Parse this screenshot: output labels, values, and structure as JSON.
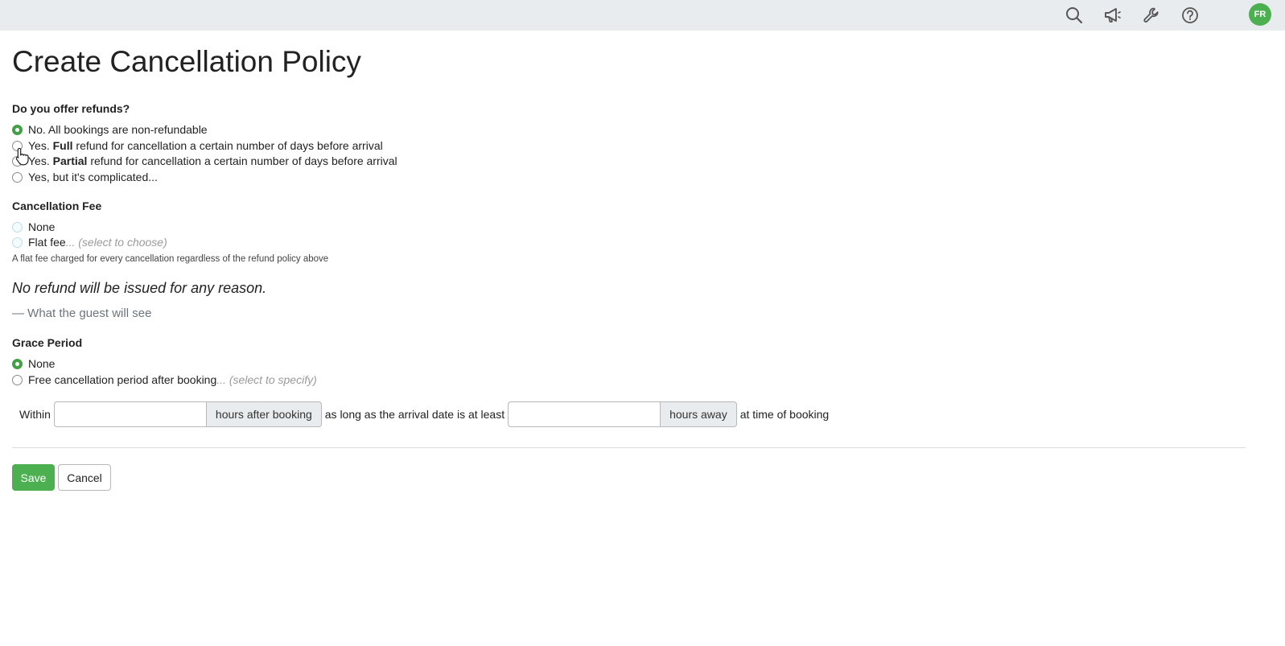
{
  "header": {
    "icons": [
      "search-icon",
      "megaphone-icon",
      "wrench-icon",
      "help-icon"
    ],
    "avatar_initials": "FR",
    "avatar_color": "#4caf50",
    "background": "#e9ecef"
  },
  "page_title": "Create Cancellation Policy",
  "refunds": {
    "label": "Do you offer refunds?",
    "selected": "non_refundable",
    "options": {
      "non_refundable": {
        "text": "No. All bookings are non-refundable"
      },
      "full": {
        "pre": "Yes. ",
        "bold": "Full",
        "post": " refund for cancellation a certain number of days before arrival"
      },
      "partial": {
        "pre": "Yes. ",
        "bold": "Partial",
        "post": " refund for cancellation a certain number of days before arrival"
      },
      "complicated": {
        "text": "Yes, but it's complicated..."
      }
    }
  },
  "cancellation_fee": {
    "label": "Cancellation Fee",
    "options": {
      "none": {
        "text": "None"
      },
      "flat": {
        "text": "Flat fee",
        "hint": "... (select to choose)"
      }
    },
    "help_text": "A flat fee charged for every cancellation regardless of the refund policy above"
  },
  "preview": {
    "text": "No refund will be issued for any reason.",
    "caption": "— What the guest will see"
  },
  "grace_period": {
    "label": "Grace Period",
    "selected": "none",
    "options": {
      "none": {
        "text": "None"
      },
      "free": {
        "text": "Free cancellation period after booking",
        "hint": "... (select to specify)"
      }
    },
    "row": {
      "within": "Within",
      "hours_value": "",
      "hours_addon": "hours after booking",
      "middle": "as long as the arrival date is at least",
      "away_value": "",
      "away_addon": "hours away",
      "suffix": "at time of booking"
    }
  },
  "actions": {
    "save": "Save",
    "cancel": "Cancel",
    "save_color": "#4caf50"
  }
}
